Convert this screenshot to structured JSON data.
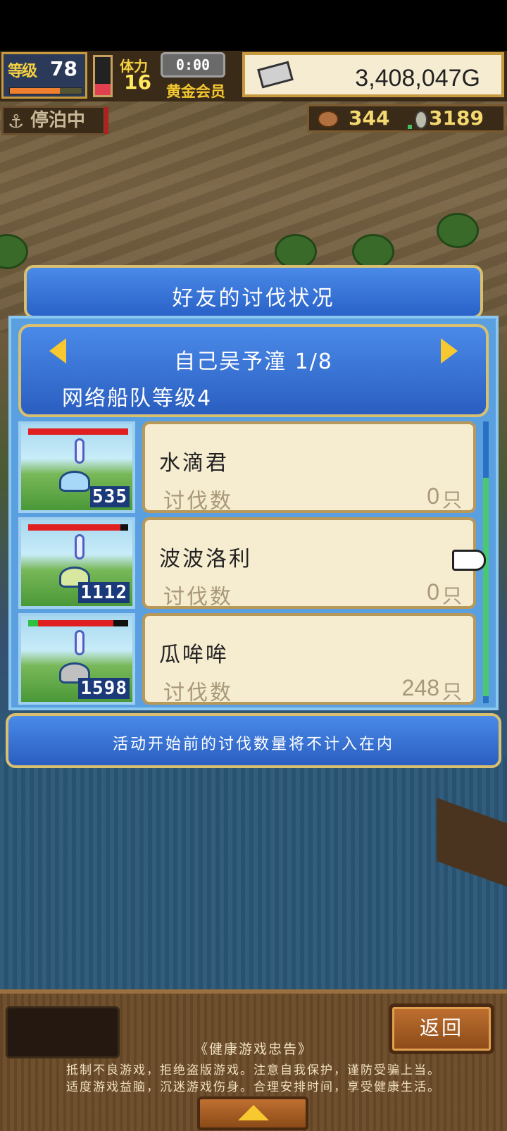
{
  "hud": {
    "level_label": "等级",
    "level": "78",
    "level_progress": 0.7,
    "stamina_label": "体力",
    "stamina": "16",
    "stamina_gauge": 0.3,
    "timer": "0:00",
    "membership": "黄金会员",
    "gold": "3,408,047G",
    "status": "停泊中",
    "fish_count": "344",
    "coin_count": "3189"
  },
  "dialog": {
    "title": "好友的讨伐状况",
    "friend": "自己吴予潼 1/8",
    "fleet_level": "网络船队等级4",
    "notice": "活动开始前的讨伐数量将不计入在内"
  },
  "monsters": [
    {
      "name": "水滴君",
      "kill_label": "讨伐数",
      "kills": "0",
      "unit": "只",
      "number": "535",
      "hp": 1.0,
      "color": "#a8d8f8"
    },
    {
      "name": "波波洛利",
      "kill_label": "讨伐数",
      "kills": "0",
      "unit": "只",
      "number": "1112",
      "hp": 0.92,
      "color": "#d8e8a0"
    },
    {
      "name": "瓜哞哞",
      "kill_label": "讨伐数",
      "kills": "248",
      "unit": "只",
      "number": "1598",
      "hp": 0.75,
      "color": "#c0c0c0"
    }
  ],
  "bottom": {
    "back_label": "返回",
    "health_title": "《健康游戏忠告》",
    "health_line1": "抵制不良游戏，拒绝盗版游戏。注意自我保护，谨防受骗上当。",
    "health_line2": "适度游戏益脑，沉迷游戏伤身。合理安排时间，享受健康生活。"
  }
}
